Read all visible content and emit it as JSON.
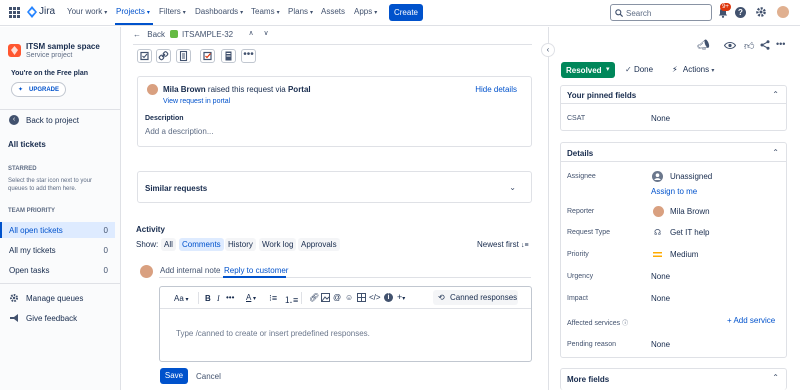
{
  "topnav": {
    "logo": "Jira",
    "items": [
      {
        "label": "Your work",
        "chevron": "▾"
      },
      {
        "label": "Projects",
        "chevron": "▾"
      },
      {
        "label": "Filters",
        "chevron": "▾"
      },
      {
        "label": "Dashboards",
        "chevron": "▾"
      },
      {
        "label": "Teams",
        "chevron": "▾"
      },
      {
        "label": "Plans",
        "chevron": "▾"
      },
      {
        "label": "Assets",
        "chevron": ""
      },
      {
        "label": "Apps",
        "chevron": "▾"
      }
    ],
    "create_label": "Create",
    "search_placeholder": "Search",
    "notification_badge": "9+",
    "accent": "#0052cc"
  },
  "sidebar": {
    "project_name": "ITSM sample space",
    "project_type": "Service project",
    "plan_text": "You're on the Free plan",
    "upgrade_label": "UPGRADE",
    "back_label": "Back to project",
    "all_tickets": "All tickets",
    "starred_heading": "STARRED",
    "starred_help": "Select the star icon next to your queues to add them here.",
    "team_priority_heading": "TEAM PRIORITY",
    "queues": [
      {
        "label": "All open tickets",
        "count": "0"
      },
      {
        "label": "All my tickets",
        "count": "0"
      },
      {
        "label": "Open tasks",
        "count": "0"
      }
    ],
    "manage_queues": "Manage queues",
    "give_feedback": "Give feedback"
  },
  "main": {
    "back_label": "Back",
    "issue_key": "ITSAMPLE-32",
    "requester_name": "Mila Brown",
    "raised_text": "raised this request via",
    "raised_via": "Portal",
    "hide_details": "Hide details",
    "view_request": "View request in portal",
    "description_label": "Description",
    "description_placeholder": "Add a description...",
    "similar_requests": "Similar requests",
    "activity_label": "Activity",
    "show_label": "Show:",
    "filters": [
      "All",
      "Comments",
      "History",
      "Work log",
      "Approvals"
    ],
    "sort_label": "Newest first",
    "tabs": {
      "internal": "Add internal note",
      "reply": "Reply to customer"
    },
    "toolbar": {
      "text_style": "Aa",
      "bold": "B",
      "italic": "I",
      "canned": "Canned responses"
    },
    "editor_placeholder": "Type /canned to create or insert predefined responses.",
    "save_label": "Save",
    "cancel_label": "Cancel"
  },
  "right": {
    "status": "Resolved",
    "status_color": "#00875a",
    "done_label": "Done",
    "actions_label": "Actions",
    "pinned_heading": "Your pinned fields",
    "csat_label": "CSAT",
    "csat_value": "None",
    "details_heading": "Details",
    "assignee_label": "Assignee",
    "assignee_value": "Unassigned",
    "assign_to_me": "Assign to me",
    "reporter_label": "Reporter",
    "reporter_value": "Mila Brown",
    "request_type_label": "Request Type",
    "request_type_value": "Get IT help",
    "priority_label": "Priority",
    "priority_value": "Medium",
    "urgency_label": "Urgency",
    "urgency_value": "None",
    "impact_label": "Impact",
    "impact_value": "None",
    "affected_label": "Affected services",
    "add_service": "+ Add service",
    "pending_label": "Pending reason",
    "pending_value": "None",
    "more_fields": "More fields"
  }
}
